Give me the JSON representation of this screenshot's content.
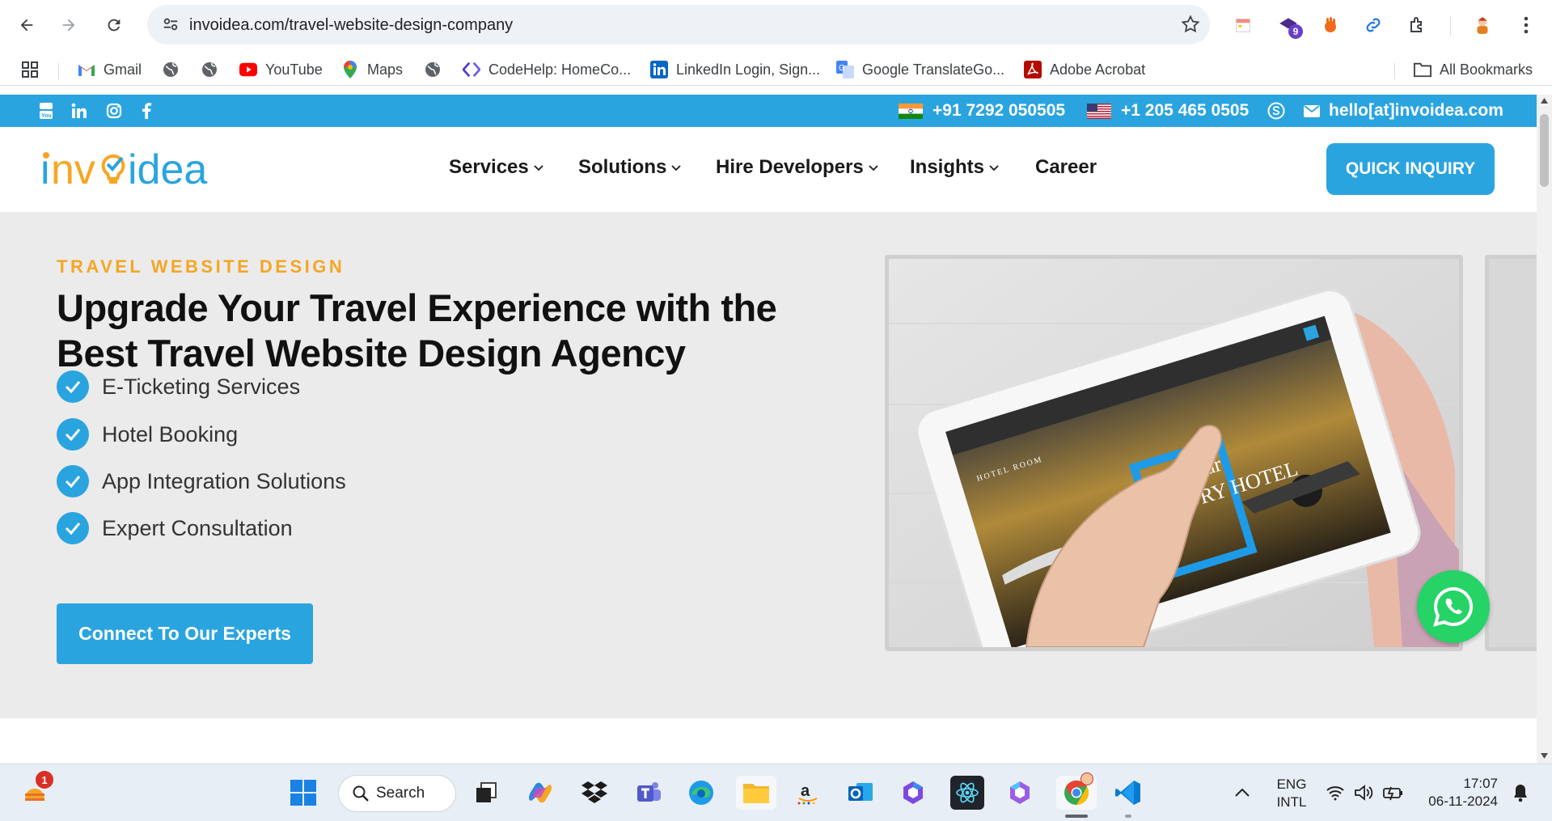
{
  "browser": {
    "url": "invoidea.com/travel-website-design-company",
    "extension_badge": "9",
    "bookmarks": [
      {
        "label": "Gmail",
        "icon": "gmail-icon"
      },
      {
        "label": "",
        "icon": "globe-icon"
      },
      {
        "label": "",
        "icon": "globe-icon"
      },
      {
        "label": "YouTube",
        "icon": "youtube-icon"
      },
      {
        "label": "Maps",
        "icon": "maps-icon"
      },
      {
        "label": "",
        "icon": "globe-icon"
      },
      {
        "label": "CodeHelp: HomeCo...",
        "icon": "codehelp-icon"
      },
      {
        "label": "LinkedIn Login, Sign...",
        "icon": "linkedin-icon"
      },
      {
        "label": "Google TranslateGo...",
        "icon": "translate-icon"
      },
      {
        "label": "Adobe Acrobat",
        "icon": "acrobat-icon"
      }
    ],
    "all_bookmarks": "All Bookmarks"
  },
  "topbar": {
    "phone_in": "+91 7292 050505",
    "phone_us": "+1 205 465 0505",
    "email": "hello[at]invoidea.com"
  },
  "header": {
    "logo_text": "invoidea",
    "nav": [
      "Services",
      "Solutions",
      "Hire Developers",
      "Insights",
      "Career"
    ],
    "inquiry": "QUICK INQUIRY"
  },
  "hero": {
    "eyebrow": "TRAVEL WEBSITE DESIGN",
    "headline": "Upgrade Your Travel Experience with the Best Travel Website Design Agency",
    "features": [
      "E-Ticketing Services",
      "Hotel Booking",
      "App Integration Solutions",
      "Expert Consultation"
    ],
    "cta": "Connect To Our Experts",
    "image_text": {
      "hotel_name": "HOTEL ROOM",
      "line1": "Super Star",
      "line2": "LUXURY HOTEL"
    }
  },
  "taskbar": {
    "search": "Search",
    "notification_badge": "1",
    "lang_top": "ENG",
    "lang_bottom": "INTL",
    "time": "17:07",
    "date": "06-11-2024"
  },
  "colors": {
    "accent": "#2aa4df",
    "eyebrow": "#f5a623",
    "whatsapp": "#25d366"
  }
}
